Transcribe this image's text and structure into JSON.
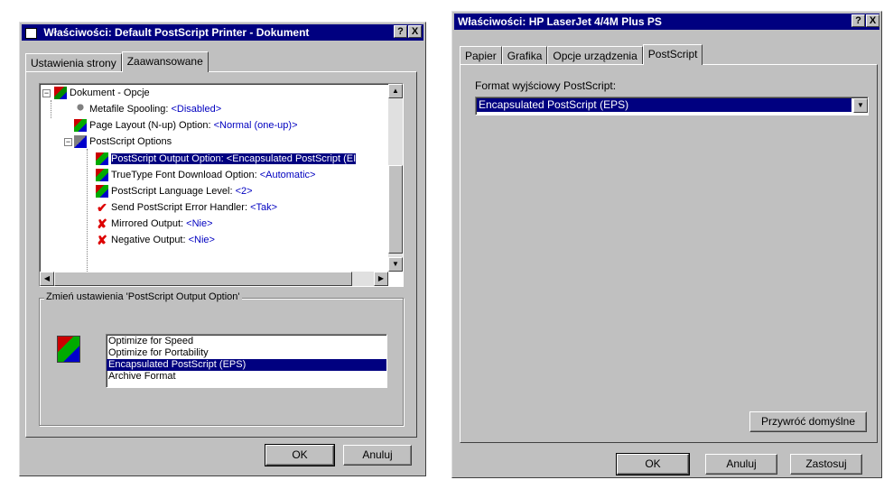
{
  "left_window": {
    "title": "Właściwości: Default PostScript Printer - Dokument",
    "help_btn": "?",
    "close_btn": "X",
    "tabs": [
      {
        "label": "Ustawienia strony"
      },
      {
        "label": "Zaawansowane"
      }
    ],
    "tree": {
      "root": "Dokument - Opcje",
      "items": [
        {
          "label": "Metafile Spooling: ",
          "value": "<Disabled>"
        },
        {
          "label": "Page Layout (N-up) Option: ",
          "value": "<Normal (one-up)>"
        },
        {
          "label": "PostScript Options",
          "value": ""
        },
        {
          "label": "PostScript Output Option: ",
          "value": "<Encapsulated PostScript (EI"
        },
        {
          "label": "TrueType Font Download Option: ",
          "value": "<Automatic>"
        },
        {
          "label": "PostScript Language Level: ",
          "value": "<2>"
        },
        {
          "label": "Send PostScript Error Handler: ",
          "value": "<Tak>"
        },
        {
          "label": "Mirrored Output: ",
          "value": "<Nie>"
        },
        {
          "label": "Negative Output: ",
          "value": "<Nie>"
        }
      ]
    },
    "group_label": "Zmień ustawienia 'PostScript Output Option'",
    "options": [
      "Optimize for Speed",
      "Optimize for Portability",
      "Encapsulated PostScript (EPS)",
      "Archive Format"
    ],
    "selected_option": 2,
    "ok_label": "OK",
    "cancel_label": "Anuluj",
    "selection_color": "#000080"
  },
  "right_window": {
    "title": "Właściwości: HP LaserJet 4/4M Plus PS",
    "help_btn": "?",
    "close_btn": "X",
    "tabs": [
      {
        "label": "Papier"
      },
      {
        "label": "Grafika"
      },
      {
        "label": "Opcje urządzenia"
      },
      {
        "label": "PostScript"
      }
    ],
    "format_label": "Format wyjściowy PostScript:",
    "format_value": "Encapsulated PostScript (EPS)",
    "restore_label": "Przywróć domyślne",
    "ok_label": "OK",
    "cancel_label": "Anuluj",
    "apply_label": "Zastosuj"
  }
}
